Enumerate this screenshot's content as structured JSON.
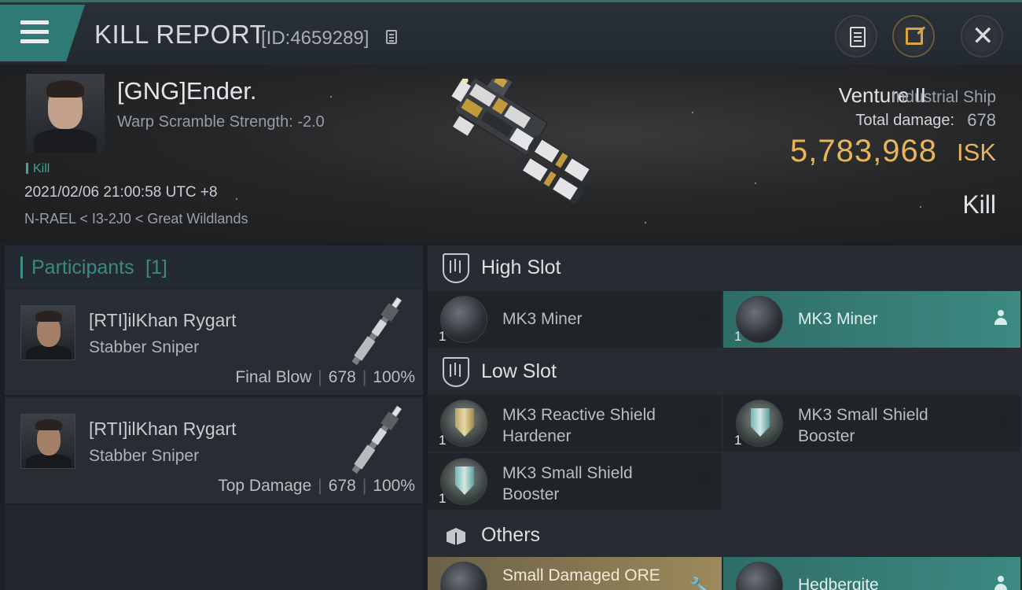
{
  "header": {
    "title": "KILL REPORT",
    "report_id": "[ID:4659289]",
    "icons": [
      "menu-icon",
      "copy-icon",
      "document-icon",
      "share-icon",
      "close-icon"
    ]
  },
  "victim": {
    "name": "[GNG]Ender.",
    "warp_text": "Warp Scramble Strength: -2.0",
    "tag": "Kill",
    "datetime": "2021/02/06 21:00:58 UTC +8",
    "location": "N-RAEL < I3-2J0 < Great Wildlands",
    "ship_name": "Venture II",
    "ship_class": "Industrial Ship",
    "total_damage_label": "Total damage:",
    "total_damage": "678",
    "isk_value": "5,783,968",
    "isk_unit": "ISK",
    "result": "Kill"
  },
  "participants": {
    "title": "Participants",
    "count": "[1]",
    "rows": [
      {
        "name": "[RTI]ilKhan Rygart",
        "ship": "Stabber Sniper",
        "role": "Final Blow",
        "damage": "678",
        "percent": "100%"
      },
      {
        "name": "[RTI]ilKhan Rygart",
        "ship": "Stabber Sniper",
        "role": "Top Damage",
        "damage": "678",
        "percent": "100%"
      }
    ]
  },
  "fitting": {
    "high_slot": {
      "label": "High Slot",
      "modules": [
        {
          "name": "MK3 Miner",
          "qty": "1",
          "state": "destroyed"
        },
        {
          "name": "MK3 Miner",
          "qty": "1",
          "state": "dropped"
        }
      ]
    },
    "low_slot": {
      "label": "Low Slot",
      "modules": [
        {
          "name": "MK3 Reactive Shield Hardener",
          "qty": "1",
          "state": "destroyed"
        },
        {
          "name": "MK3 Small Shield Booster",
          "qty": "1",
          "state": "destroyed"
        },
        {
          "name": "MK3 Small Shield Booster",
          "qty": "1",
          "state": "destroyed"
        }
      ]
    },
    "others": {
      "label": "Others",
      "modules": [
        {
          "name": "Small Damaged ORE",
          "qty": "",
          "state": "loot"
        },
        {
          "name": "Hedbergite",
          "qty": "",
          "state": "dropped"
        }
      ]
    }
  },
  "colors": {
    "accent_teal": "#3c8a82",
    "isk_gold": "#e8b55b",
    "loot_gold": "#9c8a5c"
  }
}
